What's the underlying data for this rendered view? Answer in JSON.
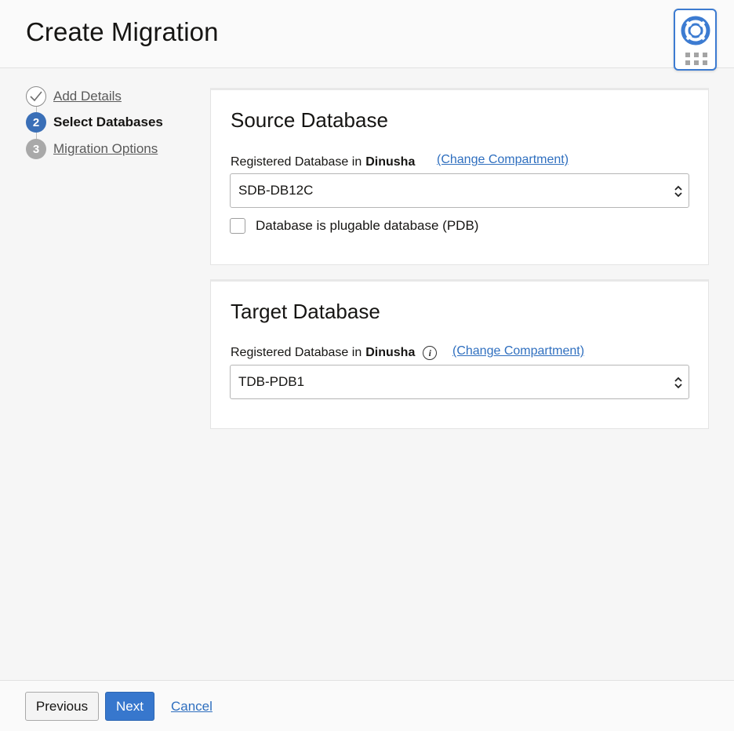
{
  "header": {
    "title": "Create Migration"
  },
  "help_widget": {
    "icon": "lifebuoy-icon",
    "grid_icon": "grid-dots-icon",
    "accent_color": "#3c7bd1"
  },
  "steps": [
    {
      "number": "1",
      "label": "Add Details",
      "state": "complete"
    },
    {
      "number": "2",
      "label": "Select Databases",
      "state": "current"
    },
    {
      "number": "3",
      "label": "Migration Options",
      "state": "upcoming"
    }
  ],
  "source": {
    "title": "Source Database",
    "label_prefix": "Registered Database in",
    "compartment": "Dinusha",
    "change_link": "(Change Compartment)",
    "selected": "SDB-DB12C",
    "checkbox_label": "Database is plugable database (PDB)",
    "checkbox_checked": false
  },
  "target": {
    "title": "Target Database",
    "label_prefix": "Registered Database in",
    "compartment": "Dinusha",
    "info_glyph": "i",
    "change_link": "(Change Compartment)",
    "selected": "TDB-PDB1"
  },
  "footer": {
    "previous_label": "Previous",
    "next_label": "Next",
    "cancel_label": "Cancel"
  },
  "colors": {
    "primary": "#3777cd",
    "link": "#2f6fbf",
    "step_current": "#3a6fb7",
    "step_upcoming": "#a9a9a9"
  }
}
